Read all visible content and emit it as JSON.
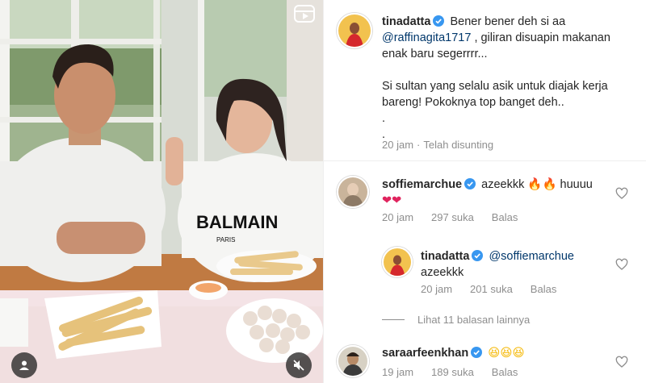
{
  "caption": {
    "username": "tinadatta",
    "text_1": "Bener bener deh si aa",
    "mention": "@raffinagita1717",
    "text_2": ", giliran disuapin makanan enak baru segerrrr...",
    "text_3": "Si sultan yang selalu asik untuk diajak kerja bareng! Pokoknya top banget deh..",
    "dot_1": ".",
    "dot_2": ".",
    "time": "20 jam",
    "separator": "·",
    "edited": "Telah disunting"
  },
  "comments": [
    {
      "username": "soffiemarchue",
      "text": "azeekkk",
      "emoji_1": "🔥",
      "emoji_2": "🔥",
      "text_2": "huuuu",
      "emoji_3": "❤❤",
      "time": "20 jam",
      "likes": "297 suka",
      "reply": "Balas"
    },
    {
      "username": "tinadatta",
      "mention": "@soffiemarchue",
      "text": "azeekkk",
      "time": "20 jam",
      "likes": "201 suka",
      "reply": "Balas"
    },
    {
      "username": "saraarfeenkhan",
      "emoji": "😆😆😆",
      "time": "19 jam",
      "likes": "189 suka",
      "reply": "Balas"
    }
  ],
  "more_replies": "Lihat 11 balasan lainnya",
  "media": {
    "shirt_text": "BALMAIN",
    "shirt_subtext": "PARIS"
  },
  "icons": {
    "reel": "reels-icon",
    "tags": "tagged-user-icon",
    "mute": "speaker-muted-icon",
    "verified": "verified-badge-icon",
    "like": "heart-outline-icon"
  },
  "colors": {
    "verified": "#3897f0",
    "mention": "#00376b",
    "muted_text": "#8e8e8e"
  }
}
